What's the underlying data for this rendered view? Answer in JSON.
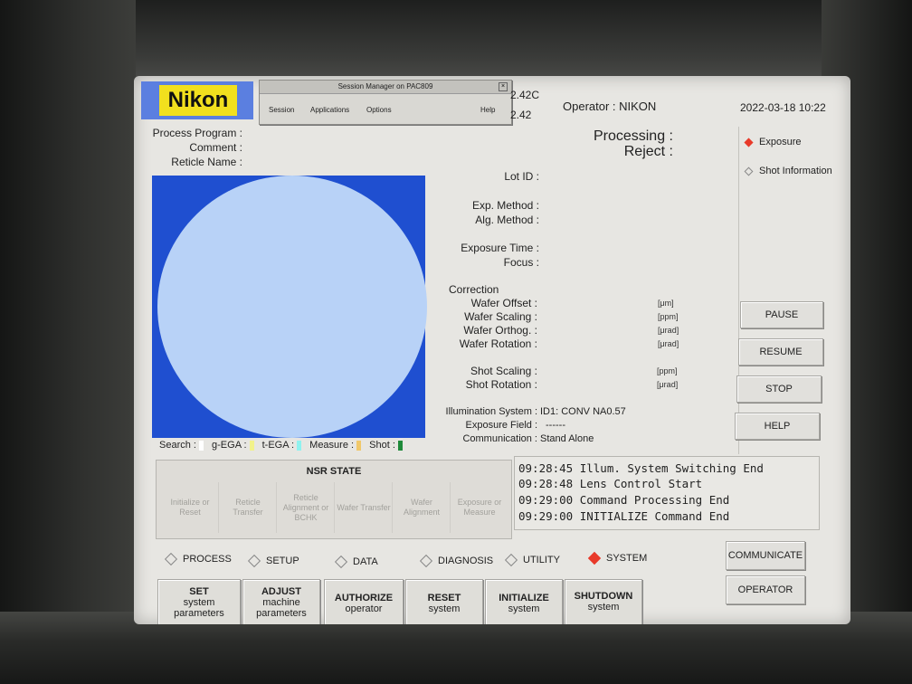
{
  "brand": "Nikon",
  "session_manager": {
    "title": "Session Manager on PAC809",
    "menu": [
      "Session",
      "Applications",
      "Options",
      "Help"
    ]
  },
  "header": {
    "value_top": "2.42C",
    "value_bottom": "2.42",
    "operator": "Operator : NIKON",
    "datetime": "2022-03-18 10:22"
  },
  "labels": {
    "process_program": "Process Program :",
    "comment": "Comment :",
    "reticle_name": "Reticle Name :",
    "processing": "Processing :",
    "reject": "Reject :",
    "lot_id": "Lot ID :",
    "exp_method": "Exp. Method :",
    "alg_method": "Alg. Method :",
    "exposure_time": "Exposure Time :",
    "focus": "Focus :",
    "correction": "Correction",
    "wafer_offset": "Wafer Offset :",
    "wafer_scaling": "Wafer Scaling :",
    "wafer_orthog": "Wafer Orthog. :",
    "wafer_rotation": "Wafer Rotation :",
    "shot_scaling": "Shot Scaling :",
    "shot_rotation": "Shot Rotation :",
    "illumination_system": "Illumination System :",
    "exposure_field": "Exposure Field :",
    "communication": "Communication :"
  },
  "values": {
    "illumination_system": "ID1: CONV NA0.57",
    "exposure_field": "------",
    "communication": "Stand Alone"
  },
  "units": {
    "wafer_offset": "[μm]",
    "wafer_scaling": "[ppm]",
    "wafer_orthog": "[μrad]",
    "wafer_rotation": "[μrad]",
    "shot_scaling": "[ppm]",
    "shot_rotation": "[μrad]"
  },
  "view_options": {
    "exposure": "Exposure",
    "shot_information": "Shot Information",
    "selected": "Exposure"
  },
  "legend": {
    "search": "Search :",
    "g_ega": "g-EGA :",
    "t_ega": "t-EGA :",
    "measure": "Measure :",
    "shot": "Shot :",
    "colors": {
      "search": "#ffffff",
      "g_ega": "#f2f28a",
      "t_ega": "#8ff2ef",
      "measure": "#f0c86a",
      "shot": "#1f8a3a"
    }
  },
  "side_buttons": [
    "PAUSE",
    "RESUME",
    "STOP",
    "HELP"
  ],
  "nsr_state": {
    "title": "NSR STATE",
    "steps": [
      "Initialize or Reset",
      "Reticle Transfer",
      "Reticle Alignment or BCHK",
      "Wafer Transfer",
      "Wafer Alignment",
      "Exposure or Measure"
    ]
  },
  "log": [
    "09:28:45 Illum. System Switching End",
    "09:28:48 Lens Control Start",
    "09:29:00 Command Processing End",
    "09:29:00 INITIALIZE Command End"
  ],
  "modes": {
    "items": [
      "PROCESS",
      "SETUP",
      "DATA",
      "DIAGNOSIS",
      "UTILITY",
      "SYSTEM"
    ],
    "selected": "SYSTEM"
  },
  "function_buttons": [
    {
      "title": "SET",
      "sub": "system parameters"
    },
    {
      "title": "ADJUST",
      "sub": "machine parameters"
    },
    {
      "title": "AUTHORIZE",
      "sub": "operator"
    },
    {
      "title": "RESET",
      "sub": "system"
    },
    {
      "title": "INITIALIZE",
      "sub": "system"
    },
    {
      "title": "SHUTDOWN",
      "sub": "system"
    }
  ],
  "right_buttons": [
    "COMMUNICATE",
    "OPERATOR"
  ],
  "colors": {
    "wafer_background": "#1f4fd0",
    "wafer": "#b8d2f7",
    "logo_blue": "#5b7fe0",
    "logo_yellow": "#f2e01e",
    "selected_indicator": "#e83a2a"
  }
}
